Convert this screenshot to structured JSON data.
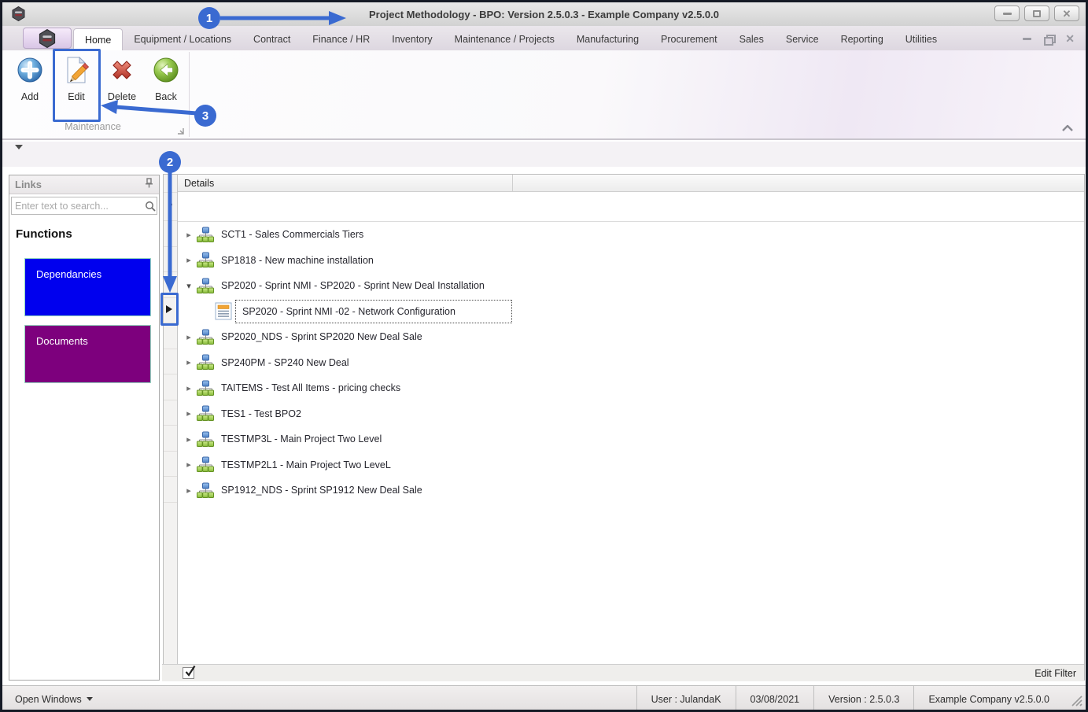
{
  "colors": {
    "annotation_accent": "#3a6ad1",
    "dependancies_button": "#0000ee",
    "documents_button": "#7d007d"
  },
  "window": {
    "title": "Project Methodology - BPO: Version 2.5.0.3 - Example Company v2.5.0.0"
  },
  "ribbon": {
    "tabs": [
      {
        "label": "Home"
      },
      {
        "label": "Equipment / Locations"
      },
      {
        "label": "Contract"
      },
      {
        "label": "Finance / HR"
      },
      {
        "label": "Inventory"
      },
      {
        "label": "Maintenance / Projects"
      },
      {
        "label": "Manufacturing"
      },
      {
        "label": "Procurement"
      },
      {
        "label": "Sales"
      },
      {
        "label": "Service"
      },
      {
        "label": "Reporting"
      },
      {
        "label": "Utilities"
      }
    ],
    "buttons": {
      "add": "Add",
      "edit": "Edit",
      "delete": "Delete",
      "back": "Back"
    },
    "group_label": "Maintenance"
  },
  "links_panel": {
    "title": "Links",
    "search_placeholder": "Enter text to search...",
    "section_title": "Functions",
    "function_buttons": [
      {
        "label": "Dependancies"
      },
      {
        "label": "Documents"
      }
    ]
  },
  "grid": {
    "column_header": "Details",
    "rows": [
      {
        "label": "SCT1 - Sales Commercials Tiers"
      },
      {
        "label": "SP1818 - New machine installation"
      },
      {
        "label": "SP2020 - Sprint NMI - SP2020 - Sprint New Deal Installation"
      },
      {
        "label": "SP2020 - Sprint NMI -02 - Network Configuration"
      },
      {
        "label": "SP2020_NDS - Sprint SP2020 New Deal Sale"
      },
      {
        "label": "SP240PM - SP240 New Deal"
      },
      {
        "label": "TAITEMS - Test All Items - pricing checks"
      },
      {
        "label": "TES1 - Test BPO2"
      },
      {
        "label": "TESTMP3L - Main Project Two Level"
      },
      {
        "label": "TESTMP2L1 - Main Project Two LeveL"
      },
      {
        "label": "SP1912_NDS - Sprint SP1912 New Deal Sale"
      }
    ],
    "edit_filter_label": "Edit Filter"
  },
  "status_bar": {
    "open_windows_label": "Open Windows",
    "user": "User : JulandaK",
    "date": "03/08/2021",
    "version": "Version : 2.5.0.3",
    "company": "Example Company v2.5.0.0"
  },
  "annotations": {
    "callout_1": "1",
    "callout_2": "2",
    "callout_3": "3"
  }
}
